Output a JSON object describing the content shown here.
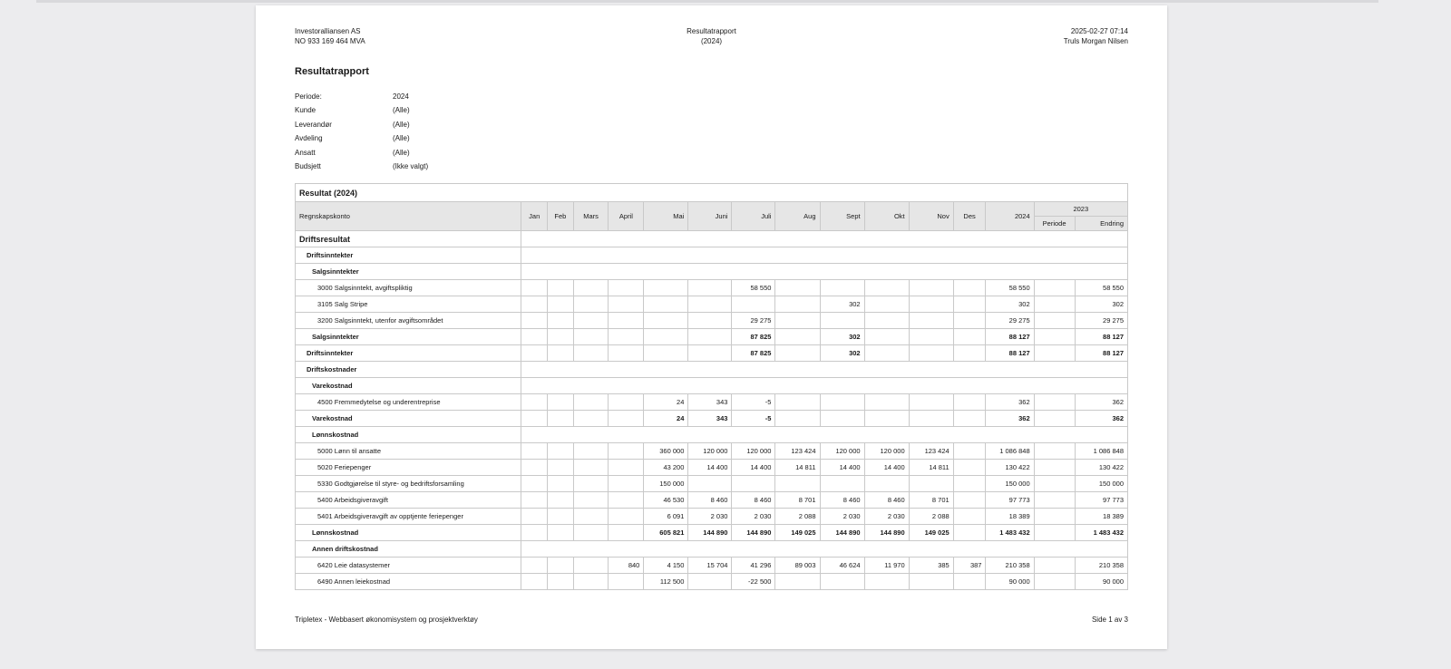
{
  "header": {
    "company": "Investoralliansen AS",
    "org_number": "NO 933 169 464 MVA",
    "report_name": "Resultatrapport",
    "report_year": "(2024)",
    "timestamp": "2025-02-27 07:14",
    "user": "Truls Morgan Nilsen"
  },
  "report_title": "Resultatrapport",
  "params": [
    {
      "label": "Periode:",
      "value": "2024"
    },
    {
      "label": "Kunde",
      "value": "(Alle)"
    },
    {
      "label": "Leverandør",
      "value": "(Alle)"
    },
    {
      "label": "Avdeling",
      "value": "(Alle)"
    },
    {
      "label": "Ansatt",
      "value": "(Alle)"
    },
    {
      "label": "Budsjett",
      "value": "(Ikke valgt)"
    }
  ],
  "table": {
    "title": "Resultat (2024)",
    "headers": {
      "account": "Regnskapskonto",
      "months": [
        "Jan",
        "Feb",
        "Mars",
        "April",
        "Mai",
        "Juni",
        "Juli",
        "Aug",
        "Sept",
        "Okt",
        "Nov",
        "Des"
      ],
      "year": "2024",
      "prev_year": "2023",
      "periode": "Periode",
      "endring": "Endring"
    },
    "rows": [
      {
        "label": "Driftsresultat",
        "type": "section",
        "values": []
      },
      {
        "label": "Driftsinntekter",
        "type": "group",
        "values": []
      },
      {
        "label": "Salgsinntekter",
        "type": "sub",
        "values": []
      },
      {
        "label": "3000 Salgsinntekt, avgiftspliktig",
        "type": "account",
        "values": [
          "",
          "",
          "",
          "",
          "",
          "",
          "58 550",
          "",
          "",
          "",
          "",
          "",
          "58 550",
          "",
          "58 550"
        ]
      },
      {
        "label": "3105 Salg Stripe",
        "type": "account",
        "values": [
          "",
          "",
          "",
          "",
          "",
          "",
          "",
          "",
          "302",
          "",
          "",
          "",
          "302",
          "",
          "302"
        ]
      },
      {
        "label": "3200 Salgsinntekt, utenfor avgiftsområdet",
        "type": "account",
        "values": [
          "",
          "",
          "",
          "",
          "",
          "",
          "29 275",
          "",
          "",
          "",
          "",
          "",
          "29 275",
          "",
          "29 275"
        ]
      },
      {
        "label": "Salgsinntekter",
        "type": "subtotal",
        "values": [
          "",
          "",
          "",
          "",
          "",
          "",
          "87 825",
          "",
          "302",
          "",
          "",
          "",
          "88 127",
          "",
          "88 127"
        ]
      },
      {
        "label": "Driftsinntekter",
        "type": "total",
        "values": [
          "",
          "",
          "",
          "",
          "",
          "",
          "87 825",
          "",
          "302",
          "",
          "",
          "",
          "88 127",
          "",
          "88 127"
        ]
      },
      {
        "label": "Driftskostnader",
        "type": "group",
        "values": []
      },
      {
        "label": "Varekostnad",
        "type": "sub",
        "values": []
      },
      {
        "label": "4500 Fremmedytelse og underentreprise",
        "type": "account",
        "values": [
          "",
          "",
          "",
          "",
          "24",
          "343",
          "-5",
          "",
          "",
          "",
          "",
          "",
          "362",
          "",
          "362"
        ]
      },
      {
        "label": "Varekostnad",
        "type": "subtotal",
        "values": [
          "",
          "",
          "",
          "",
          "24",
          "343",
          "-5",
          "",
          "",
          "",
          "",
          "",
          "362",
          "",
          "362"
        ]
      },
      {
        "label": "Lønnskostnad",
        "type": "sub",
        "values": []
      },
      {
        "label": "5000 Lønn til ansatte",
        "type": "account",
        "values": [
          "",
          "",
          "",
          "",
          "360 000",
          "120 000",
          "120 000",
          "123 424",
          "120 000",
          "120 000",
          "123 424",
          "",
          "1 086 848",
          "",
          "1 086 848"
        ]
      },
      {
        "label": "5020 Feriepenger",
        "type": "account",
        "values": [
          "",
          "",
          "",
          "",
          "43 200",
          "14 400",
          "14 400",
          "14 811",
          "14 400",
          "14 400",
          "14 811",
          "",
          "130 422",
          "",
          "130 422"
        ]
      },
      {
        "label": "5330 Godtgjørelse til styre- og bedriftsforsamling",
        "type": "account",
        "values": [
          "",
          "",
          "",
          "",
          "150 000",
          "",
          "",
          "",
          "",
          "",
          "",
          "",
          "150 000",
          "",
          "150 000"
        ]
      },
      {
        "label": "5400 Arbeidsgiveravgift",
        "type": "account",
        "values": [
          "",
          "",
          "",
          "",
          "46 530",
          "8 460",
          "8 460",
          "8 701",
          "8 460",
          "8 460",
          "8 701",
          "",
          "97 773",
          "",
          "97 773"
        ]
      },
      {
        "label": "5401 Arbeidsgiveravgift av opptjente feriepenger",
        "type": "account",
        "values": [
          "",
          "",
          "",
          "",
          "6 091",
          "2 030",
          "2 030",
          "2 088",
          "2 030",
          "2 030",
          "2 088",
          "",
          "18 389",
          "",
          "18 389"
        ]
      },
      {
        "label": "Lønnskostnad",
        "type": "subtotal",
        "values": [
          "",
          "",
          "",
          "",
          "605 821",
          "144 890",
          "144 890",
          "149 025",
          "144 890",
          "144 890",
          "149 025",
          "",
          "1 483 432",
          "",
          "1 483 432"
        ]
      },
      {
        "label": "Annen driftskostnad",
        "type": "sub",
        "values": []
      },
      {
        "label": "6420 Leie datasystemer",
        "type": "account",
        "values": [
          "",
          "",
          "",
          "840",
          "4 150",
          "15 704",
          "41 296",
          "89 003",
          "46 624",
          "11 970",
          "385",
          "387",
          "210 358",
          "",
          "210 358"
        ]
      },
      {
        "label": "6490 Annen leiekostnad",
        "type": "account",
        "values": [
          "",
          "",
          "",
          "",
          "112 500",
          "",
          "-22 500",
          "",
          "",
          "",
          "",
          "",
          "90 000",
          "",
          "90 000"
        ]
      }
    ]
  },
  "footer": {
    "left": "Tripletex - Webbasert økonomisystem og prosjektverktøy",
    "right": "Side 1 av 3"
  }
}
